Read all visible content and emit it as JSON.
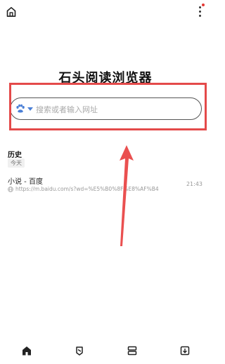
{
  "app": {
    "title": "石头阅读浏览器"
  },
  "search": {
    "placeholder": "搜索或者输入网址",
    "engine_icon": "baidu-paw-icon"
  },
  "history": {
    "heading": "历史",
    "group_label": "今天",
    "items": [
      {
        "title": "小说 - 百度",
        "url": "https://m.baidu.com/s?wd=%E5%B0%8F%E8%AF%B4",
        "time": "21:43"
      }
    ]
  },
  "colors": {
    "highlight": "#e44a4a",
    "arrow": "#ea5050",
    "engine": "#4a7fd6"
  },
  "bottom_nav": [
    {
      "name": "home-tab",
      "icon": "home-icon"
    },
    {
      "name": "reader-tab",
      "icon": "reader-icon"
    },
    {
      "name": "tabs-tab",
      "icon": "tabs-icon"
    },
    {
      "name": "download-tab",
      "icon": "download-icon"
    }
  ]
}
